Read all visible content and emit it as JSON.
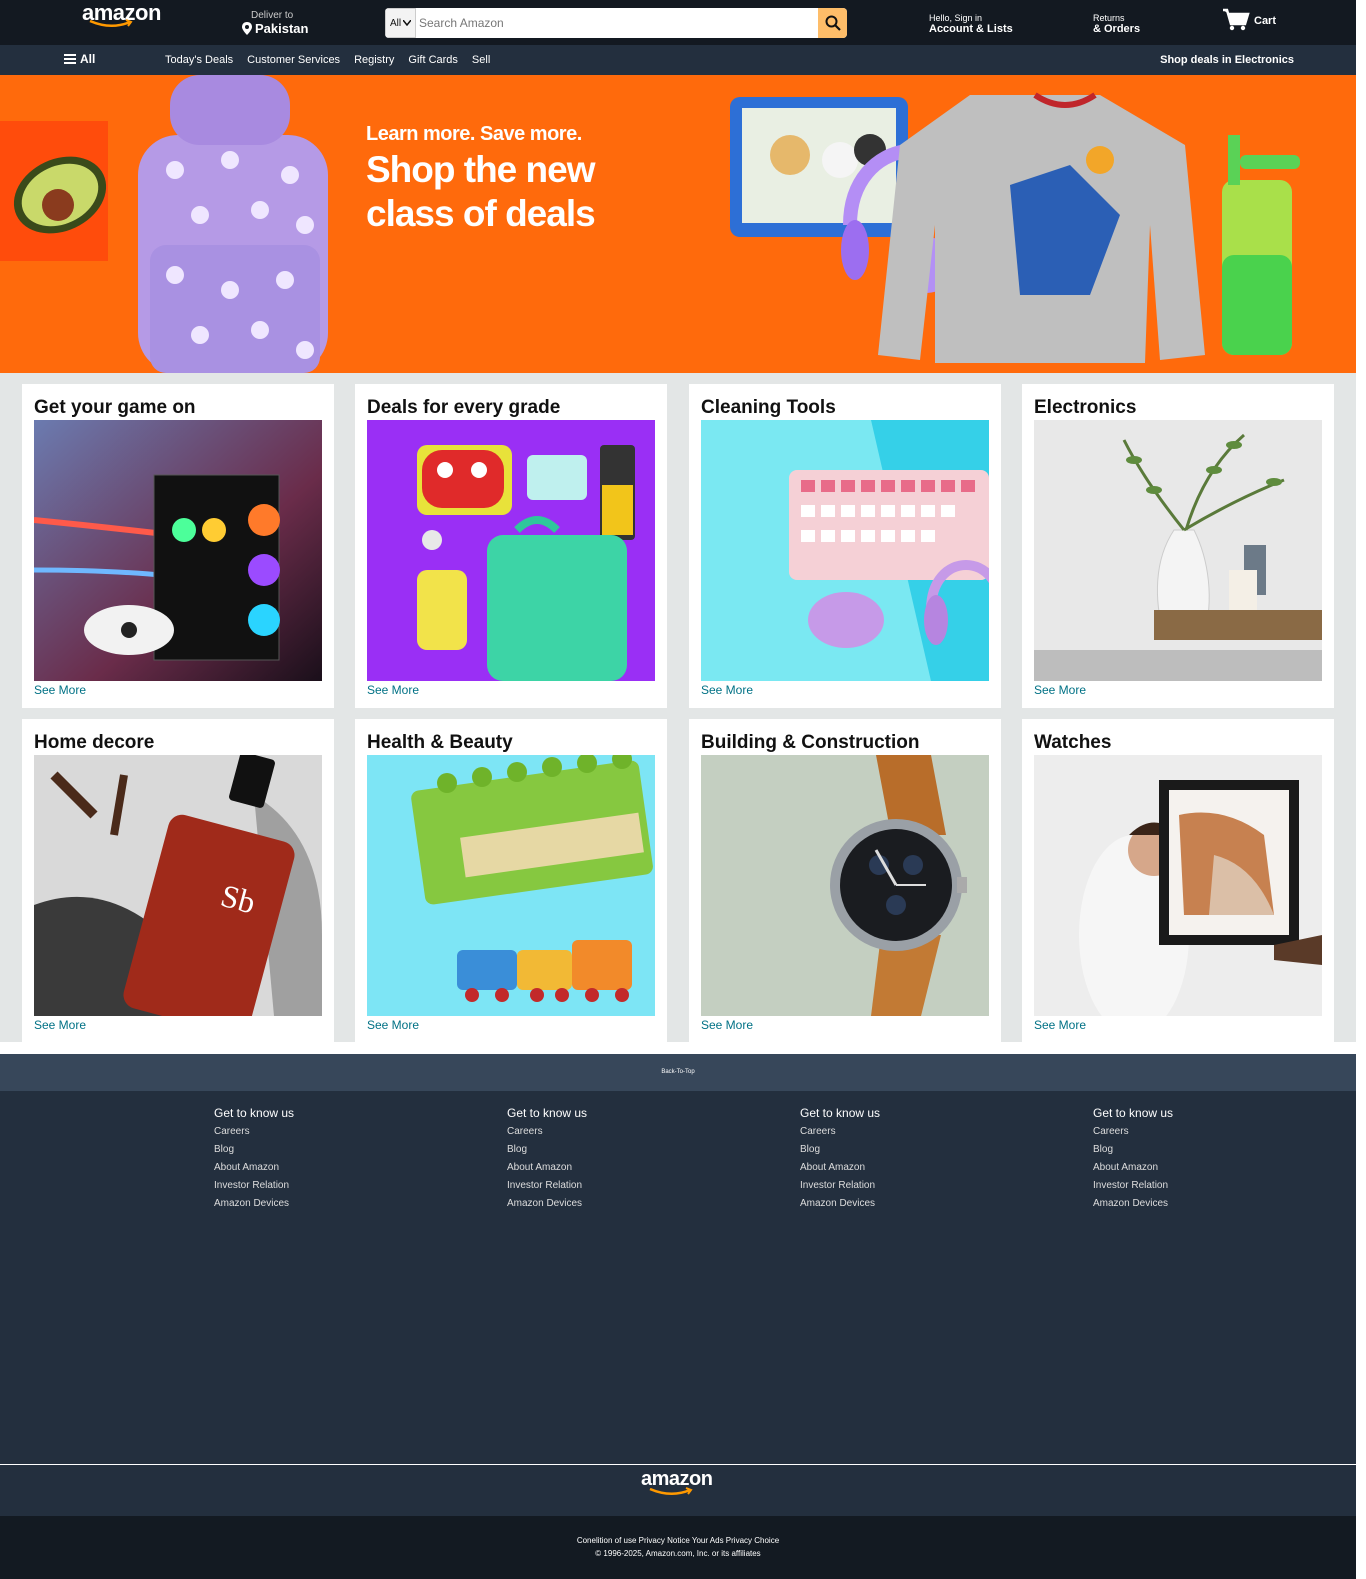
{
  "header": {
    "logo": "amazon",
    "deliver_line1": "Deliver to",
    "deliver_line2": "Pakistan",
    "search_category": "All",
    "search_placeholder": "Search Amazon",
    "account_line1": "Hello, Sign in",
    "account_line2": "Account & Lists",
    "returns_line1": "Returns",
    "returns_line2": "& Orders",
    "cart_label": "Cart"
  },
  "subnav": {
    "all_label": "All",
    "links": [
      "Today's Deals",
      "Customer Services",
      "Registry",
      "Gift Cards",
      "Sell"
    ],
    "right_link": "Shop deals in Electronics"
  },
  "hero": {
    "line1": "Learn more. Save more.",
    "line2": "Shop the new",
    "line3": "class of deals"
  },
  "cards": [
    {
      "title": "Get your game on",
      "link": "See More"
    },
    {
      "title": "Deals for every grade",
      "link": "See More"
    },
    {
      "title": "Cleaning Tools",
      "link": "See More"
    },
    {
      "title": "Electronics",
      "link": "See More"
    },
    {
      "title": "Home decore",
      "link": "See More"
    },
    {
      "title": "Health & Beauty",
      "link": "See More"
    },
    {
      "title": "Building & Construction",
      "link": "See More"
    },
    {
      "title": "Watches",
      "link": "See More"
    }
  ],
  "footer": {
    "back_to_top": "Back-To-Top",
    "columns": [
      {
        "heading": "Get to know us",
        "items": [
          "Careers",
          "Blog",
          "About Amazon",
          "Investor Relation",
          "Amazon Devices"
        ]
      },
      {
        "heading": "Get to know us",
        "items": [
          "Careers",
          "Blog",
          "About Amazon",
          "Investor Relation",
          "Amazon Devices"
        ]
      },
      {
        "heading": "Get to know us",
        "items": [
          "Careers",
          "Blog",
          "About Amazon",
          "Investor Relation",
          "Amazon Devices"
        ]
      },
      {
        "heading": "Get to know us",
        "items": [
          "Careers",
          "Blog",
          "About Amazon",
          "Investor Relation",
          "Amazon Devices"
        ]
      }
    ],
    "logo": "amazon",
    "legal_line1": "Conelition of use Privacy Notice Your Ads Privacy Choice",
    "legal_line2": "© 1996-2025, Amazon.com, Inc. or its affiliates"
  },
  "colors": {
    "nav_dark": "#131921",
    "nav_secondary": "#232f3e",
    "search_button": "#febd69",
    "hero_orange": "#ff6a0c",
    "link_teal": "#007185",
    "smile_orange": "#ff9900"
  }
}
